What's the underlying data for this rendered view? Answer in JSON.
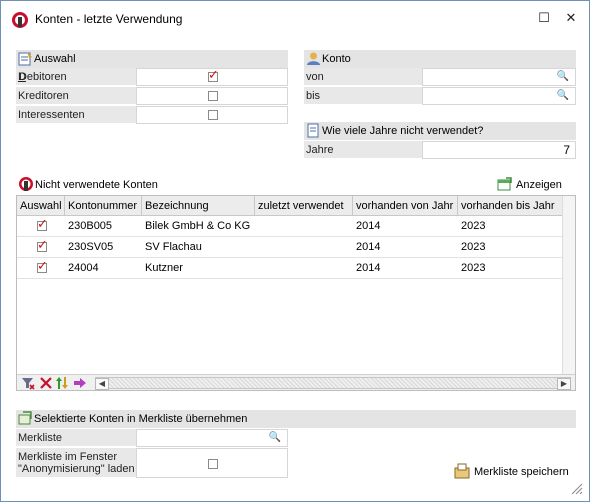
{
  "window": {
    "title": "Konten - letzte Verwendung",
    "maximize_glyph": "☐",
    "close_glyph": "✕"
  },
  "auswahl": {
    "title": "Auswahl",
    "rows": [
      {
        "label": "Debitoren",
        "checked": true
      },
      {
        "label": "Kreditoren",
        "checked": false
      },
      {
        "label": "Interessenten",
        "checked": false
      }
    ]
  },
  "konto": {
    "title": "Konto",
    "von_label": "von",
    "von_value": "",
    "bis_label": "bis",
    "bis_value": ""
  },
  "jahre": {
    "title": "Wie viele Jahre nicht verwendet?",
    "label": "Jahre",
    "value": "7"
  },
  "nicht_verwendet": {
    "title": "Nicht verwendete Konten",
    "anzeigen_label": "Anzeigen",
    "columns": [
      "Auswahl",
      "Kontonummer",
      "Bezeichnung",
      "zuletzt verwendet",
      "vorhanden von Jahr",
      "vorhanden bis Jahr"
    ],
    "rows": [
      {
        "selected": true,
        "kontonummer": "230B005",
        "bezeichnung": "Bilek GmbH & Co KG",
        "zuletzt": "",
        "von_jahr": "2014",
        "bis_jahr": "2023"
      },
      {
        "selected": true,
        "kontonummer": "230SV05",
        "bezeichnung": "SV Flachau",
        "zuletzt": "",
        "von_jahr": "2014",
        "bis_jahr": "2023"
      },
      {
        "selected": true,
        "kontonummer": "24004",
        "bezeichnung": "Kutzner",
        "zuletzt": "",
        "von_jahr": "2014",
        "bis_jahr": "2023"
      }
    ]
  },
  "merkliste": {
    "title": "Selektierte Konten in Merkliste übernehmen",
    "merkliste_label": "Merkliste",
    "merkliste_value": "",
    "laden_label_line1": "Merkliste im Fenster",
    "laden_label_line2": "\"Anonymisierung\" laden",
    "laden_checked": false,
    "speichern_label": "Merkliste speichern"
  },
  "icons": {
    "checkmark_glyph": "✓",
    "search_glyph": "🔍",
    "scroll_left": "◀",
    "scroll_right": "▶"
  },
  "colors": {
    "checkmark": "#d01010",
    "section_bg": "#e4e4e4",
    "label_bg": "#e8e8e8"
  }
}
